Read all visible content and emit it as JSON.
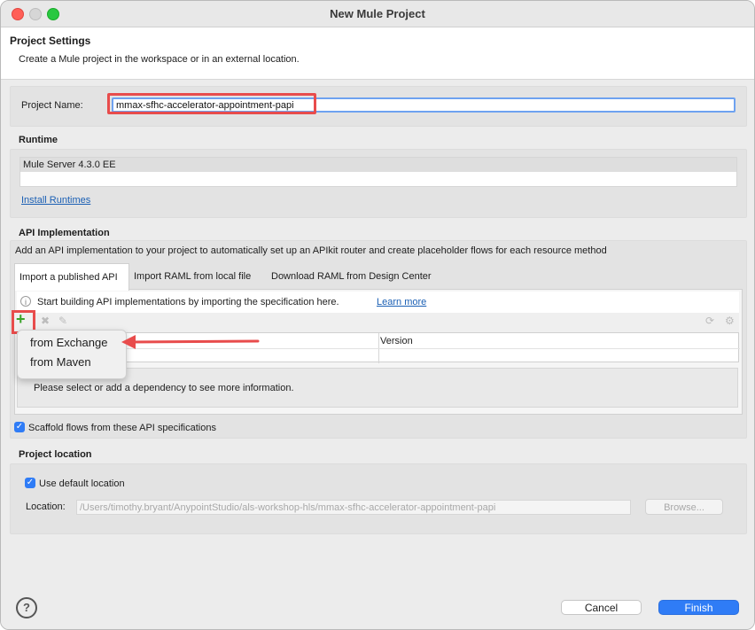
{
  "window": {
    "title": "New Mule Project"
  },
  "header": {
    "title": "Project Settings",
    "description": "Create a Mule project in the workspace or in an external location."
  },
  "project_name": {
    "label": "Project Name:",
    "value": "mmax-sfhc-accelerator-appointment-papi"
  },
  "runtime": {
    "title": "Runtime",
    "selected": "Mule Server 4.3.0 EE",
    "install_link": "Install Runtimes"
  },
  "api_impl": {
    "title": "API Implementation",
    "description": "Add an API implementation to your project to automatically set up an APIkit router and create placeholder flows for each resource method",
    "tabs": [
      "Import a published API",
      "Import RAML from local file",
      "Download RAML from Design Center"
    ],
    "info_text": "Start building API implementations by importing the specification here.",
    "learn_more": "Learn more",
    "table_headers": [
      "",
      "Version"
    ],
    "detail_text": "Please select or add a dependency to see more information.",
    "add_menu": [
      "from Exchange",
      "from Maven"
    ],
    "scaffold_label": "Scaffold flows from these API specifications",
    "scaffold_checked": true
  },
  "location": {
    "title": "Project location",
    "use_default_label": "Use default location",
    "use_default_checked": true,
    "location_label": "Location:",
    "location_value": "/Users/timothy.bryant/AnypointStudio/als-workshop-hls/mmax-sfhc-accelerator-appointment-papi",
    "browse_label": "Browse..."
  },
  "footer": {
    "help": "?",
    "cancel": "Cancel",
    "finish": "Finish"
  },
  "colors": {
    "highlight": "#e84c4c",
    "primary_button": "#2f7cf6",
    "link": "#1a5fb4"
  },
  "icons": [
    "plus-icon",
    "delete-icon",
    "edit-icon",
    "refresh-icon",
    "settings-icon",
    "info-icon",
    "help-icon",
    "checkmark-icon",
    "arrow-annotation-icon"
  ]
}
